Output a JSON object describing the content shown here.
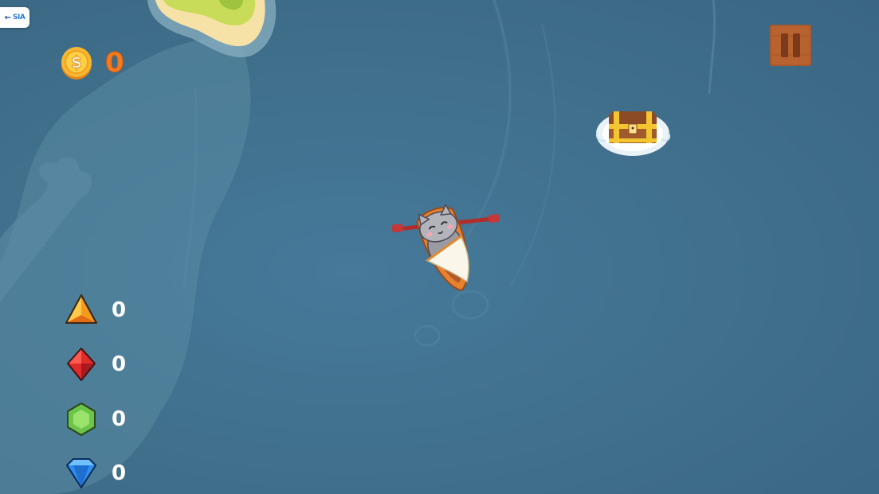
{
  "colors": {
    "sea": "#3f6f8b",
    "coin_count": "#f47a1f",
    "gem_count": "#ffffff",
    "pause_wood": "#a9592b"
  },
  "back_button": {
    "arrow": "←",
    "logo_text": "SIA"
  },
  "coins": {
    "icon": "coin-icon",
    "count": "0"
  },
  "pause": {
    "icon": "pause-icon"
  },
  "gems": [
    {
      "name": "orange-triangle-gem",
      "count": "0"
    },
    {
      "name": "red-diamond-gem",
      "count": "0"
    },
    {
      "name": "green-hexagon-gem",
      "count": "0"
    },
    {
      "name": "blue-diamond-gem",
      "count": "0"
    }
  ],
  "scene": {
    "player": "cat-in-rowboat",
    "pickup": "treasure-chest",
    "terrain": "sandy-island"
  }
}
